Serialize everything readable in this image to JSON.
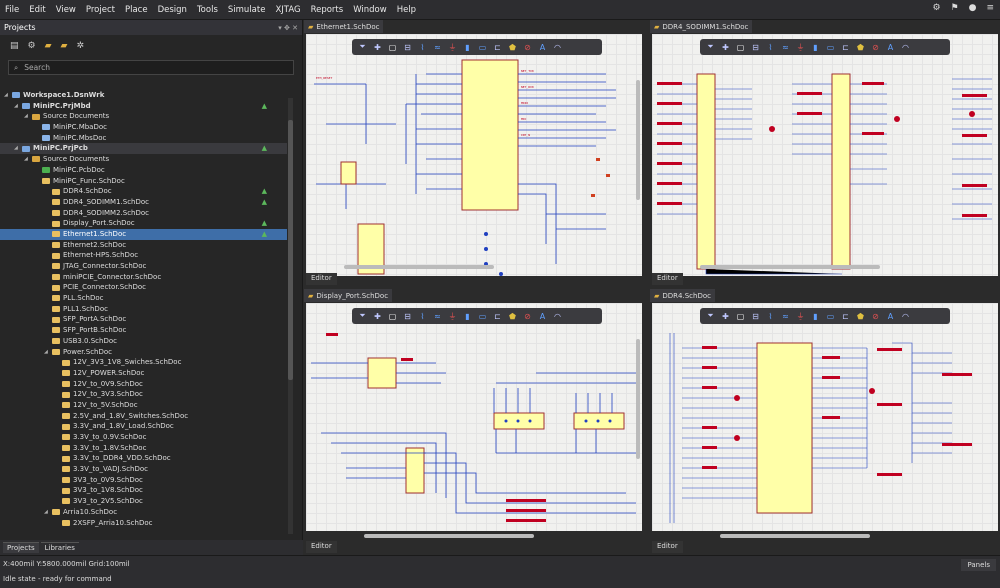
{
  "menu": [
    "File",
    "Edit",
    "View",
    "Project",
    "Place",
    "Design",
    "Tools",
    "Simulate",
    "XJTAG",
    "Reports",
    "Window",
    "Help"
  ],
  "projects_panel": {
    "title": "Projects",
    "search_placeholder": "Search",
    "tree": [
      {
        "label": "Workspace1.DsnWrk",
        "level": 0,
        "kind": "ws",
        "bold": true
      },
      {
        "label": "MiniPC.PrjMbd",
        "level": 1,
        "kind": "proj",
        "bold": true,
        "flag": true
      },
      {
        "label": "Source Documents",
        "level": 2,
        "kind": "folder"
      },
      {
        "label": "MiniPC.MbaDoc",
        "level": 3,
        "kind": "doc"
      },
      {
        "label": "MiniPC.MbsDoc",
        "level": 3,
        "kind": "doc"
      },
      {
        "label": "MiniPC.PrjPcb",
        "level": 1,
        "kind": "proj",
        "bold": true,
        "flag": true,
        "hl": true
      },
      {
        "label": "Source Documents",
        "level": 2,
        "kind": "folder"
      },
      {
        "label": "MiniPC.PcbDoc",
        "level": 3,
        "kind": "pcb"
      },
      {
        "label": "MiniPC_Func.SchDoc",
        "level": 3,
        "kind": "sch"
      },
      {
        "label": "DDR4.SchDoc",
        "level": 4,
        "kind": "sch",
        "flag": true
      },
      {
        "label": "DDR4_SODIMM1.SchDoc",
        "level": 4,
        "kind": "sch",
        "flag": true
      },
      {
        "label": "DDR4_SODIMM2.SchDoc",
        "level": 4,
        "kind": "sch"
      },
      {
        "label": "Display_Port.SchDoc",
        "level": 4,
        "kind": "sch",
        "flag": true
      },
      {
        "label": "Ethernet1.SchDoc",
        "level": 4,
        "kind": "sch",
        "flag": true,
        "selected": true
      },
      {
        "label": "Ethernet2.SchDoc",
        "level": 4,
        "kind": "sch"
      },
      {
        "label": "Ethernet-HPS.SchDoc",
        "level": 4,
        "kind": "sch"
      },
      {
        "label": "JTAG_Connector.SchDoc",
        "level": 4,
        "kind": "sch"
      },
      {
        "label": "miniPCIE_Connector.SchDoc",
        "level": 4,
        "kind": "sch"
      },
      {
        "label": "PCIE_Connector.SchDoc",
        "level": 4,
        "kind": "sch"
      },
      {
        "label": "PLL.SchDoc",
        "level": 4,
        "kind": "sch"
      },
      {
        "label": "PLL1.SchDoc",
        "level": 4,
        "kind": "sch"
      },
      {
        "label": "SFP_PortA.SchDoc",
        "level": 4,
        "kind": "sch"
      },
      {
        "label": "SFP_PortB.SchDoc",
        "level": 4,
        "kind": "sch"
      },
      {
        "label": "USB3.0.SchDoc",
        "level": 4,
        "kind": "sch"
      },
      {
        "label": "Power.SchDoc",
        "level": 4,
        "kind": "sch",
        "expanded": true
      },
      {
        "label": "12V_3V3_1V8_Swiches.SchDoc",
        "level": 5,
        "kind": "sch"
      },
      {
        "label": "12V_POWER.SchDoc",
        "level": 5,
        "kind": "sch"
      },
      {
        "label": "12V_to_0V9.SchDoc",
        "level": 5,
        "kind": "sch"
      },
      {
        "label": "12V_to_3V3.SchDoc",
        "level": 5,
        "kind": "sch"
      },
      {
        "label": "12V_to_5V.SchDoc",
        "level": 5,
        "kind": "sch"
      },
      {
        "label": "2.5V_and_1.8V_Switches.SchDoc",
        "level": 5,
        "kind": "sch"
      },
      {
        "label": "3.3V_and_1.8V_Load.SchDoc",
        "level": 5,
        "kind": "sch"
      },
      {
        "label": "3.3V_to_0.9V.SchDoc",
        "level": 5,
        "kind": "sch"
      },
      {
        "label": "3.3V_to_1.8V.SchDoc",
        "level": 5,
        "kind": "sch"
      },
      {
        "label": "3.3V_to_DDR4_VDD.SchDoc",
        "level": 5,
        "kind": "sch"
      },
      {
        "label": "3.3V_to_VADJ.SchDoc",
        "level": 5,
        "kind": "sch"
      },
      {
        "label": "3V3_to_0V9.SchDoc",
        "level": 5,
        "kind": "sch"
      },
      {
        "label": "3V3_to_1V8.SchDoc",
        "level": 5,
        "kind": "sch"
      },
      {
        "label": "3V3_to_2V5.SchDoc",
        "level": 5,
        "kind": "sch"
      },
      {
        "label": "Arria10.SchDoc",
        "level": 4,
        "kind": "sch",
        "expanded": true
      },
      {
        "label": "2XSFP_Arria10.SchDoc",
        "level": 5,
        "kind": "sch"
      }
    ],
    "bottom_tabs": [
      "Projects",
      "Libraries"
    ]
  },
  "documents": [
    {
      "tab": "Ethernet1.SchDoc",
      "editor": "Editor"
    },
    {
      "tab": "DDR4_SODIMM1.SchDoc",
      "editor": "Editor"
    },
    {
      "tab": "Display_Port.SchDoc",
      "editor": "Editor"
    },
    {
      "tab": "DDR4.SchDoc",
      "editor": "Editor"
    }
  ],
  "status": {
    "coords": "X:400mil Y:5800.000mil",
    "grid": "Grid:100mil",
    "state": "Idle state - ready for command",
    "panels": "Panels"
  },
  "colors": {
    "bg": "#2b2b2b",
    "sheet": "#f1f1ef",
    "selection": "#3e6ea8",
    "wire": "#2040c0",
    "part": "#ffffa8",
    "net": "#c00020"
  }
}
